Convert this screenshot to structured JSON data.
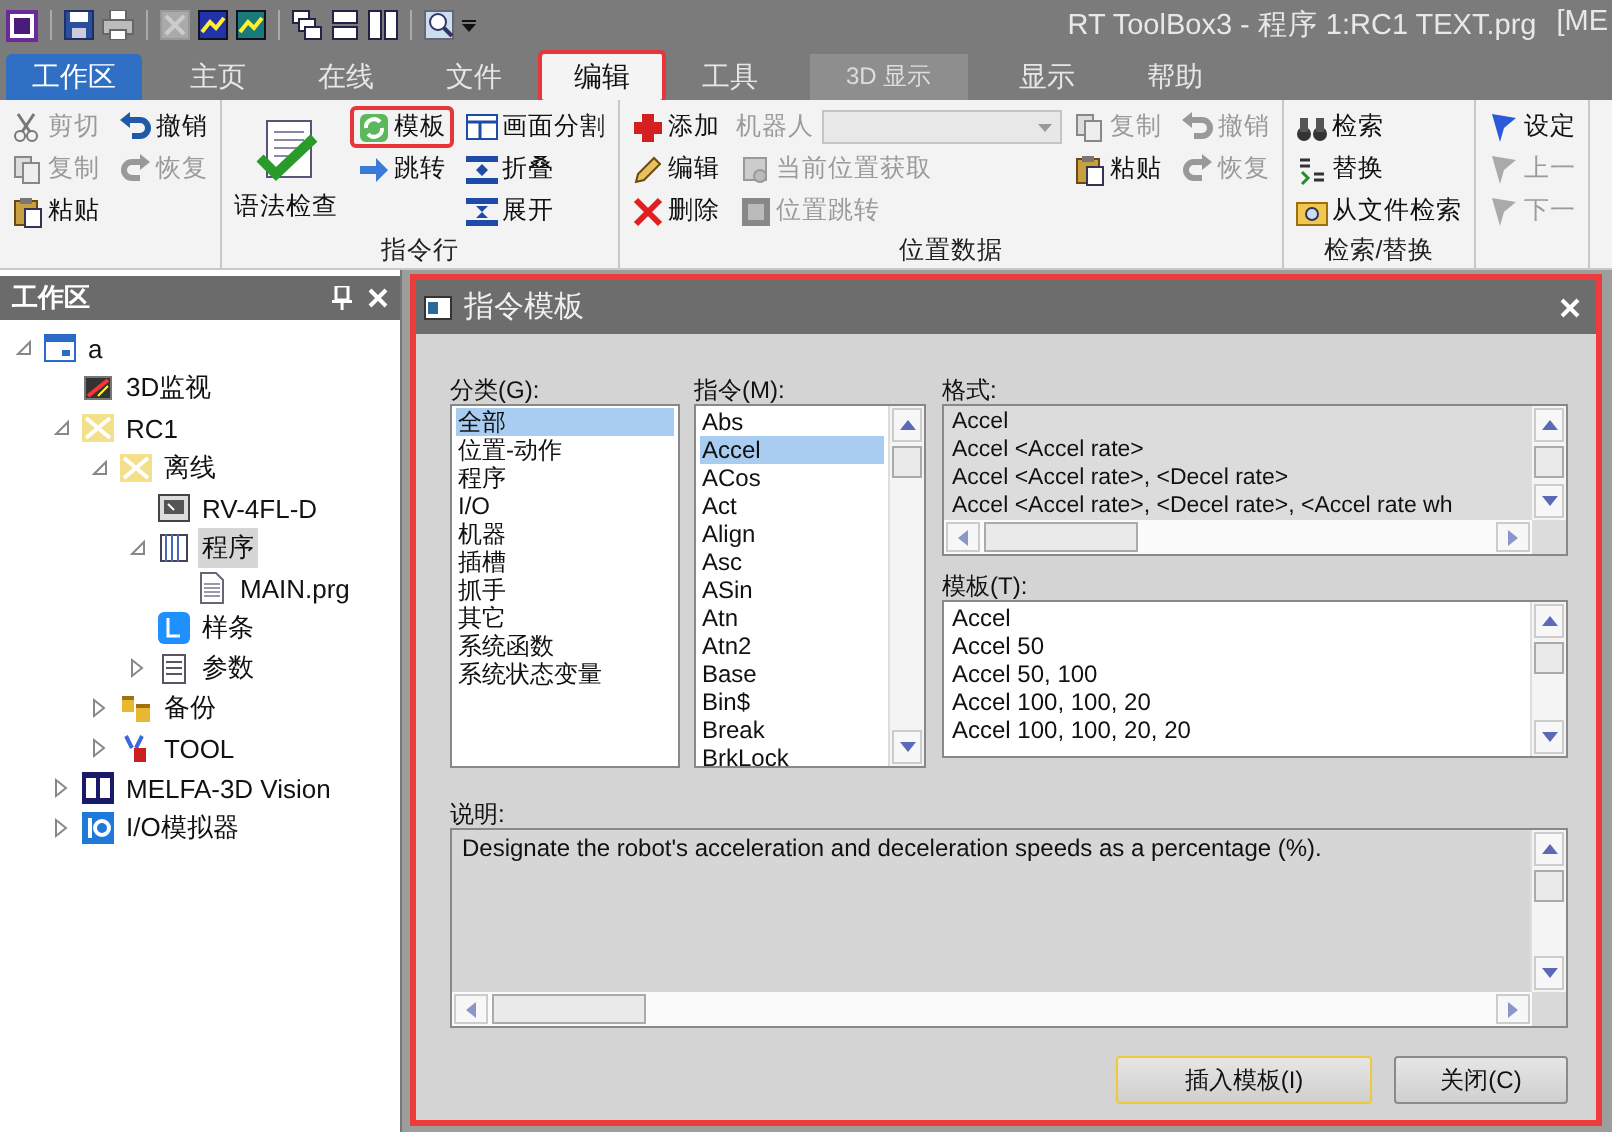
{
  "window": {
    "title": "RT ToolBox3 - 程序 1:RC1 TEXT.prg",
    "title_cut": "[ME"
  },
  "tabs": [
    {
      "label": "工作区",
      "kind": "file",
      "selected": false,
      "highlighted": false
    },
    {
      "label": "主页",
      "kind": "tab",
      "selected": false,
      "highlighted": false
    },
    {
      "label": "在线",
      "kind": "tab",
      "selected": false,
      "highlighted": false
    },
    {
      "label": "文件",
      "kind": "tab",
      "selected": false,
      "highlighted": false
    },
    {
      "label": "编辑",
      "kind": "tab",
      "selected": true,
      "highlighted": true
    },
    {
      "label": "工具",
      "kind": "tab",
      "selected": false,
      "highlighted": false
    },
    {
      "label": "3D 显示",
      "kind": "context",
      "selected": false,
      "highlighted": false
    },
    {
      "label": "显示",
      "kind": "tab",
      "selected": false,
      "highlighted": false
    },
    {
      "label": "帮助",
      "kind": "tab",
      "selected": false,
      "highlighted": false
    }
  ],
  "ribbon": {
    "groups": [
      {
        "columns": [
          [
            {
              "label": "剪切",
              "kind": "small",
              "disabled": true
            },
            {
              "label": "复制",
              "kind": "small",
              "disabled": true
            },
            {
              "label": "粘贴",
              "kind": "small",
              "disabled": false
            }
          ],
          [
            {
              "label": "撤销",
              "kind": "small",
              "disabled": false
            },
            {
              "label": "恢复",
              "kind": "small",
              "disabled": true
            }
          ]
        ]
      },
      {
        "label": "指令行",
        "columns": [
          [
            {
              "label": "语法检查",
              "kind": "large",
              "disabled": false
            }
          ],
          [
            {
              "label": "模板",
              "kind": "small",
              "disabled": false,
              "highlighted": true
            },
            {
              "label": "跳转",
              "kind": "small",
              "disabled": false
            }
          ],
          [
            {
              "label": "画面分割",
              "kind": "small",
              "disabled": false
            },
            {
              "label": "折叠",
              "kind": "small",
              "disabled": false
            },
            {
              "label": "展开",
              "kind": "small",
              "disabled": false
            }
          ]
        ]
      },
      {
        "label": "位置数据",
        "columns": [
          [
            {
              "label": "添加",
              "kind": "small",
              "disabled": false
            },
            {
              "label": "编辑",
              "kind": "small",
              "disabled": false
            },
            {
              "label": "删除",
              "kind": "small",
              "disabled": false
            }
          ],
          [
            {
              "label": "机器人",
              "kind": "combo",
              "disabled": true
            },
            {
              "label": "当前位置获取",
              "kind": "small",
              "disabled": true
            },
            {
              "label": "位置跳转",
              "kind": "small",
              "disabled": true
            }
          ],
          [
            {
              "label": "复制",
              "kind": "small",
              "disabled": true
            },
            {
              "label": "粘贴",
              "kind": "small",
              "disabled": false
            }
          ],
          [
            {
              "label": "撤销",
              "kind": "small",
              "disabled": true
            },
            {
              "label": "恢复",
              "kind": "small",
              "disabled": true
            }
          ]
        ]
      },
      {
        "label": "检索/替换",
        "columns": [
          [
            {
              "label": "检索",
              "kind": "small",
              "disabled": false
            },
            {
              "label": "替换",
              "kind": "small",
              "disabled": false
            },
            {
              "label": "从文件检索",
              "kind": "small",
              "disabled": false
            }
          ]
        ]
      },
      {
        "columns": [
          [
            {
              "label": "设定",
              "kind": "small",
              "disabled": false
            },
            {
              "label": "上一",
              "kind": "small",
              "disabled": true
            },
            {
              "label": "下一",
              "kind": "small",
              "disabled": true
            }
          ]
        ]
      }
    ]
  },
  "workspace": {
    "title": "工作区",
    "tree": [
      {
        "label": "a",
        "expanded": true,
        "selected": false,
        "children": [
          {
            "label": "3D监视",
            "selected": false
          },
          {
            "label": "RC1",
            "expanded": true,
            "selected": false,
            "children": [
              {
                "label": "离线",
                "expanded": true,
                "selected": false,
                "children": [
                  {
                    "label": "RV-4FL-D",
                    "selected": false
                  },
                  {
                    "label": "程序",
                    "expanded": true,
                    "selected": true,
                    "children": [
                      {
                        "label": "MAIN.prg",
                        "selected": false
                      }
                    ]
                  },
                  {
                    "label": "样条",
                    "selected": false
                  },
                  {
                    "label": "参数",
                    "expanded": false,
                    "selected": false
                  }
                ]
              },
              {
                "label": "备份",
                "expanded": false,
                "selected": false
              },
              {
                "label": "TOOL",
                "expanded": false,
                "selected": false
              }
            ]
          },
          {
            "label": "MELFA-3D Vision",
            "expanded": false,
            "selected": false
          },
          {
            "label": "I/O模拟器",
            "expanded": false,
            "selected": false
          }
        ]
      }
    ]
  },
  "dialog": {
    "title": "指令模板",
    "highlighted": true,
    "category": {
      "label": "分类(G):",
      "items": [
        {
          "text": "全部",
          "selected": true
        },
        {
          "text": "位置-动作",
          "selected": false
        },
        {
          "text": "程序",
          "selected": false
        },
        {
          "text": "I/O",
          "selected": false
        },
        {
          "text": "机器",
          "selected": false
        },
        {
          "text": "插槽",
          "selected": false
        },
        {
          "text": "抓手",
          "selected": false
        },
        {
          "text": "其它",
          "selected": false
        },
        {
          "text": "系统函数",
          "selected": false
        },
        {
          "text": "系统状态变量",
          "selected": false
        }
      ]
    },
    "command": {
      "label": "指令(M):",
      "items": [
        {
          "text": "Abs",
          "selected": false
        },
        {
          "text": "Accel",
          "selected": true
        },
        {
          "text": "ACos",
          "selected": false
        },
        {
          "text": "Act",
          "selected": false
        },
        {
          "text": "Align",
          "selected": false
        },
        {
          "text": "Asc",
          "selected": false
        },
        {
          "text": "ASin",
          "selected": false
        },
        {
          "text": "Atn",
          "selected": false
        },
        {
          "text": "Atn2",
          "selected": false
        },
        {
          "text": "Base",
          "selected": false
        },
        {
          "text": "Bin$",
          "selected": false
        },
        {
          "text": "Break",
          "selected": false
        },
        {
          "text": "BrkLock",
          "selected": false
        }
      ]
    },
    "format": {
      "label": "格式:",
      "lines": [
        "Accel",
        "Accel  <Accel rate>",
        "Accel  <Accel rate>, <Decel rate>",
        "Accel  <Accel rate>, <Decel rate>, <Accel rate wh"
      ]
    },
    "template": {
      "label": "模板(T):",
      "lines": [
        "Accel",
        "Accel 50",
        "Accel 50, 100",
        "Accel 100, 100, 20",
        "Accel 100, 100, 20, 20"
      ]
    },
    "description": {
      "label": "说明:",
      "text": "Designate the robot's acceleration and deceleration speeds as a percentage (%)."
    },
    "buttons": [
      {
        "label": "插入模板(I)",
        "focused": true
      },
      {
        "label": "关闭(C)",
        "focused": false
      }
    ]
  }
}
